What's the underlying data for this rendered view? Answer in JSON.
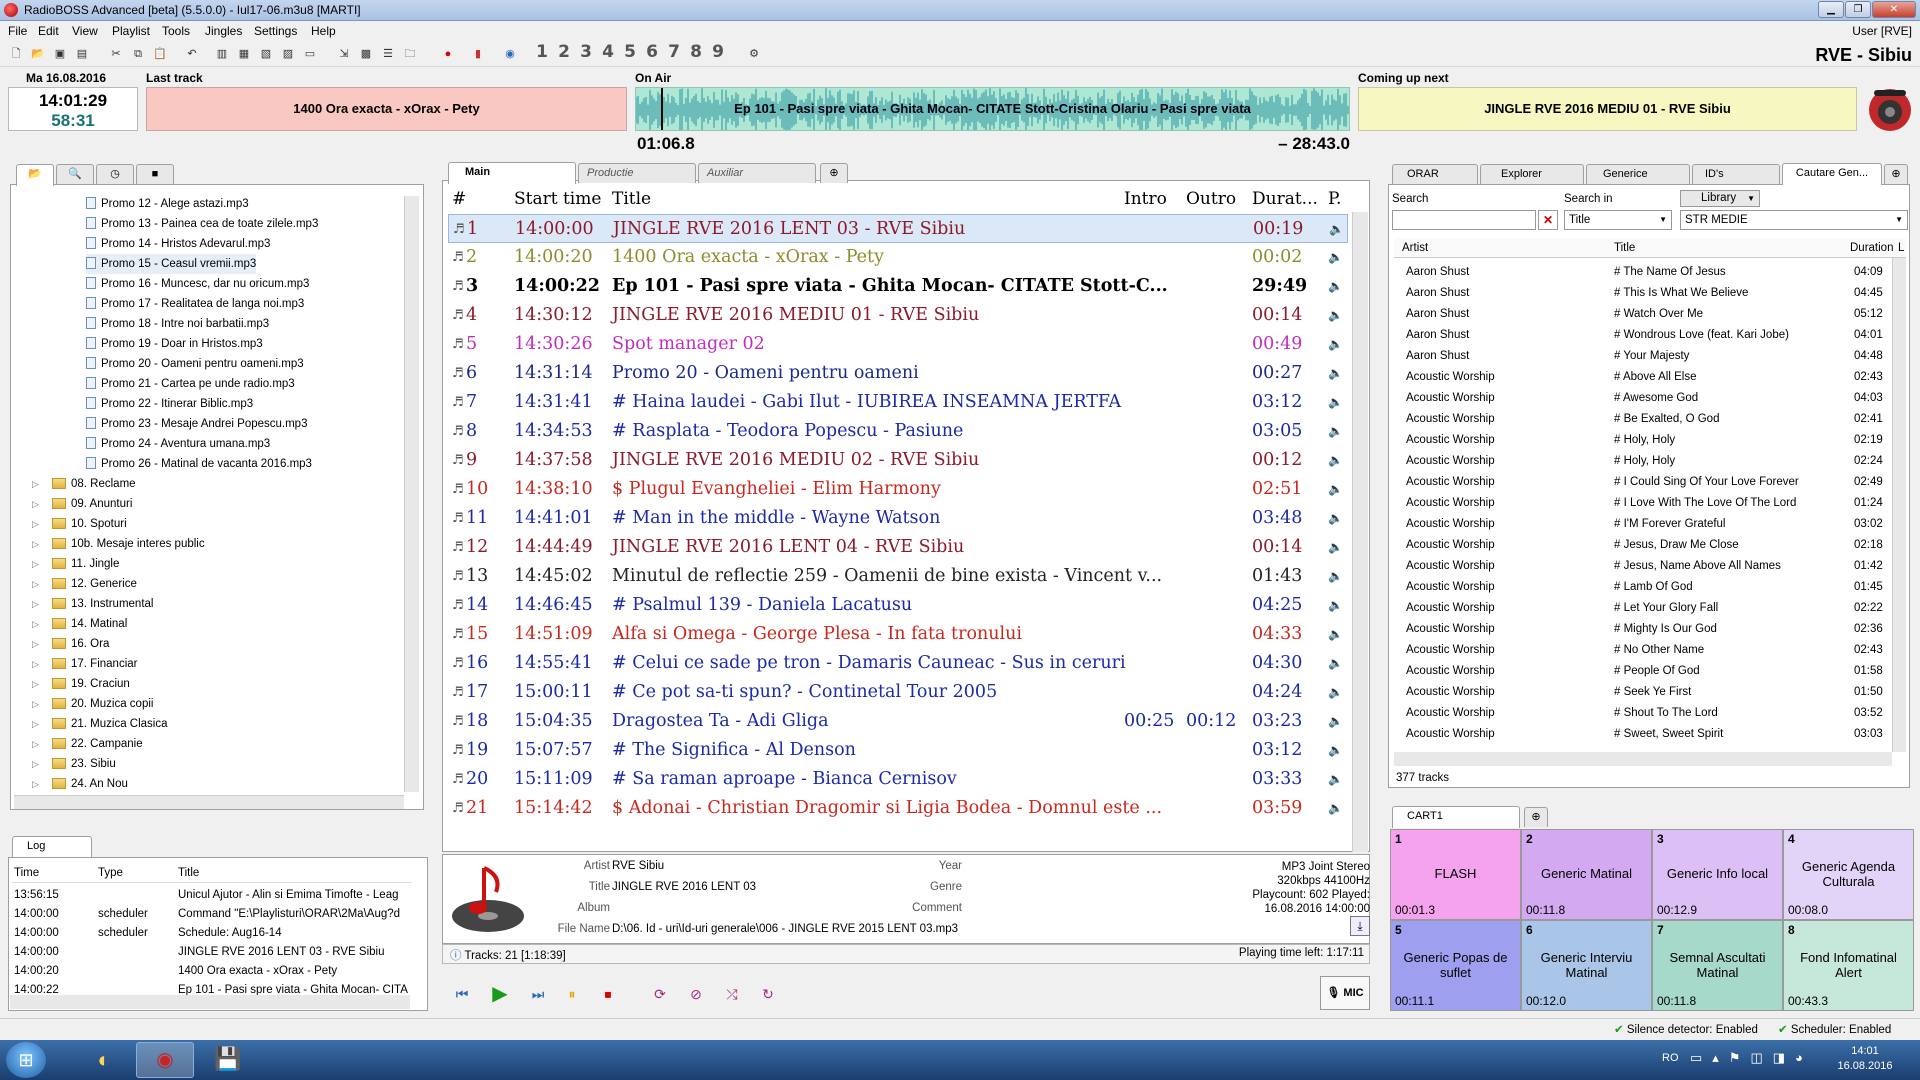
{
  "window": {
    "title": "RadioBOSS Advanced [beta] (5.5.0.0) - Iul17-06.m3u8 [MARTI]"
  },
  "menu": [
    "File",
    "Edit",
    "View",
    "Playlist",
    "Tools",
    "Jingles",
    "Settings",
    "Help"
  ],
  "user": "User [RVE]",
  "station": "RVE - Sibiu",
  "toolbar_numbers": [
    "1",
    "2",
    "3",
    "4",
    "5",
    "6",
    "7",
    "8",
    "9"
  ],
  "clock": {
    "date": "Ma 16.08.2016",
    "time": "14:01:29",
    "countdown": "58:31"
  },
  "last_track": {
    "label": "Last track",
    "title": "1400 Ora exacta - xOrax - Pety"
  },
  "on_air": {
    "label": "On Air",
    "title": "Ep 101 - Pasi spre viata - Ghita Mocan- CITATE Stott-Cristina Olariu - Pasi spre viata",
    "elapsed": "01:06.8",
    "remaining": "– 28:43.0",
    "progress": 0.037
  },
  "coming_up": {
    "label": "Coming up next",
    "title": "JINGLE RVE 2016 MEDIU 01 - RVE Sibiu"
  },
  "left_tree": {
    "files": [
      "Promo 12 - Alege astazi.mp3",
      "Promo 13 - Painea cea de toate zilele.mp3",
      "Promo 14 - Hristos Adevarul.mp3",
      "Promo 15 - Ceasul vremii.mp3",
      "Promo 16 - Muncesc, dar nu oricum.mp3",
      "Promo 17 - Realitatea de langa noi.mp3",
      "Promo 18 - Intre noi barbatii.mp3",
      "Promo 19 - Doar in Hristos.mp3",
      "Promo 20 - Oameni pentru oameni.mp3",
      "Promo 21 - Cartea pe unde radio.mp3",
      "Promo 22 - Itinerar Biblic.mp3",
      "Promo 23 - Mesaje Andrei Popescu.mp3",
      "Promo 24 - Aventura umana.mp3",
      "Promo 26 - Matinal de vacanta 2016.mp3"
    ],
    "folders": [
      "08. Reclame",
      "09. Anunturi",
      "10. Spoturi",
      "10b. Mesaje interes public",
      "11. Jingle",
      "12. Generice",
      "13. Instrumental",
      "14. Matinal",
      "16. Ora",
      "17. Financiar",
      "19. Craciun",
      "20. Muzica copii",
      "21. Muzica Clasica",
      "22. Campanie",
      "23. Sibiu",
      "24. An Nou"
    ]
  },
  "log": {
    "tab": "Log",
    "headers": [
      "Time",
      "Type",
      "Title"
    ],
    "rows": [
      [
        "13:56:15",
        "",
        "Unicul Ajutor - Alin si Emima Timofte - Leag"
      ],
      [
        "14:00:00",
        "scheduler",
        "Command \"E:\\Playlisturi\\ORAR\\2Ma\\Aug?d"
      ],
      [
        "14:00:00",
        "scheduler",
        "Schedule: Aug16-14"
      ],
      [
        "14:00:00",
        "",
        "JINGLE RVE 2016 LENT 03 - RVE Sibiu"
      ],
      [
        "14:00:20",
        "",
        "1400 Ora exacta - xOrax - Pety"
      ],
      [
        "14:00:22",
        "",
        "Ep 101 - Pasi spre viata - Ghita Mocan- CITA"
      ]
    ]
  },
  "playlist": {
    "tabs": [
      "Main",
      "Productie",
      "Auxiliar"
    ],
    "headers": [
      "#",
      "Start time",
      "Title",
      "Intro",
      "Outro",
      "Durat...",
      "P."
    ],
    "rows": [
      {
        "n": "1",
        "start": "14:00:00",
        "title": "JINGLE RVE 2016 LENT 03 - RVE Sibiu",
        "intro": "",
        "outro": "",
        "dur": "00:19",
        "color": "#8b1a2a"
      },
      {
        "n": "2",
        "start": "14:00:20",
        "title": "1400 Ora exacta - xOrax - Pety",
        "intro": "",
        "outro": "",
        "dur": "00:02",
        "color": "#8c8c2a"
      },
      {
        "n": "3",
        "start": "14:00:22",
        "title": "Ep 101 - Pasi spre viata - Ghita Mocan- CITATE Stott-C...",
        "intro": "",
        "outro": "",
        "dur": "29:49",
        "color": "#000000"
      },
      {
        "n": "4",
        "start": "14:30:12",
        "title": "JINGLE RVE 2016 MEDIU 01 - RVE Sibiu",
        "intro": "",
        "outro": "",
        "dur": "00:14",
        "color": "#8b1a2a"
      },
      {
        "n": "5",
        "start": "14:30:26",
        "title": "Spot manager 02",
        "intro": "",
        "outro": "",
        "dur": "00:49",
        "color": "#c02cc0"
      },
      {
        "n": "6",
        "start": "14:31:14",
        "title": "Promo 20 - Oameni pentru oameni",
        "intro": "",
        "outro": "",
        "dur": "00:27",
        "color": "#1a2a8b"
      },
      {
        "n": "7",
        "start": "14:31:41",
        "title": "# Haina laudei - Gabi Ilut - IUBIREA INSEAMNA JERTFA",
        "intro": "",
        "outro": "",
        "dur": "03:12",
        "color": "#1a2aa8"
      },
      {
        "n": "8",
        "start": "14:34:53",
        "title": "# Rasplata - Teodora Popescu - Pasiune",
        "intro": "",
        "outro": "",
        "dur": "03:05",
        "color": "#1a2aa8"
      },
      {
        "n": "9",
        "start": "14:37:58",
        "title": "JINGLE RVE 2016 MEDIU 02 - RVE Sibiu",
        "intro": "",
        "outro": "",
        "dur": "00:12",
        "color": "#8b1a2a"
      },
      {
        "n": "10",
        "start": "14:38:10",
        "title": "$ Plugul Evangheliei - Elim Harmony",
        "intro": "",
        "outro": "",
        "dur": "02:51",
        "color": "#c8281e"
      },
      {
        "n": "11",
        "start": "14:41:01",
        "title": "# Man in the middle - Wayne Watson",
        "intro": "",
        "outro": "",
        "dur": "03:48",
        "color": "#1a2aa8"
      },
      {
        "n": "12",
        "start": "14:44:49",
        "title": "JINGLE RVE 2016 LENT 04 - RVE Sibiu",
        "intro": "",
        "outro": "",
        "dur": "00:14",
        "color": "#8b1a2a"
      },
      {
        "n": "13",
        "start": "14:45:02",
        "title": "Minutul de reflectie 259 - Oamenii de bine exista - Vincent v...",
        "intro": "",
        "outro": "",
        "dur": "01:43",
        "color": "#222222"
      },
      {
        "n": "14",
        "start": "14:46:45",
        "title": "# Psalmul 139 - Daniela Lacatusu",
        "intro": "",
        "outro": "",
        "dur": "04:25",
        "color": "#1a2aa8"
      },
      {
        "n": "15",
        "start": "14:51:09",
        "title": "Alfa si Omega - George Plesa - In fata tronului",
        "intro": "",
        "outro": "",
        "dur": "04:33",
        "color": "#c8281e"
      },
      {
        "n": "16",
        "start": "14:55:41",
        "title": "# Celui ce sade pe tron - Damaris Cauneac - Sus in ceruri",
        "intro": "",
        "outro": "",
        "dur": "04:30",
        "color": "#1a2aa8"
      },
      {
        "n": "17",
        "start": "15:00:11",
        "title": "# Ce pot sa-ti spun? - Continetal Tour 2005",
        "intro": "",
        "outro": "",
        "dur": "04:24",
        "color": "#1a2aa8"
      },
      {
        "n": "18",
        "start": "15:04:35",
        "title": "Dragostea Ta - Adi Gliga",
        "intro": "00:25",
        "outro": "00:12",
        "dur": "03:23",
        "color": "#1a2aa8"
      },
      {
        "n": "19",
        "start": "15:07:57",
        "title": "# The Significa - Al Denson",
        "intro": "",
        "outro": "",
        "dur": "03:12",
        "color": "#1a2aa8"
      },
      {
        "n": "20",
        "start": "15:11:09",
        "title": "# Sa raman aproape - Bianca Cernisov",
        "intro": "",
        "outro": "",
        "dur": "03:33",
        "color": "#1a2aa8"
      },
      {
        "n": "21",
        "start": "15:14:42",
        "title": "$ Adonai - Christian Dragomir si Ligia Bodea - Domnul este ...",
        "intro": "",
        "outro": "",
        "dur": "03:59",
        "color": "#c8281e"
      }
    ]
  },
  "track_info": {
    "labels": {
      "artist": "Artist",
      "title": "Title",
      "album": "Album",
      "filename": "File Name",
      "year": "Year",
      "genre": "Genre",
      "comment": "Comment"
    },
    "artist": "RVE Sibiu",
    "title": "JINGLE RVE 2016 LENT 03",
    "filename": "D:\\06. Id - uri\\Id-uri generale\\006 - JINGLE RVE 2015 LENT 03.mp3",
    "format": "MP3 Joint Stereo",
    "bitrate": "320kbps 44100Hz",
    "playcount": "Playcount: 602  Played:",
    "played": "16.08.2016 14:00:00"
  },
  "status": {
    "tracks": "Tracks: 21 [1:18:39]",
    "playing_left": "Playing time left: 1:17:11",
    "mic": "MIC"
  },
  "library": {
    "tabs": [
      "ORAR",
      "Explorer",
      "Generice",
      "ID's",
      "Cautare Gen..."
    ],
    "search_label": "Search",
    "search_in_label": "Search in",
    "search_value": "",
    "search_in": "Title",
    "library_btn": "Library",
    "library_sel": "STR MEDIE",
    "headers": [
      "Artist",
      "Title",
      "Duration",
      "L"
    ],
    "rows": [
      [
        "Aaron Shust",
        "# The Name Of Jesus",
        "04:09"
      ],
      [
        "Aaron Shust",
        "# This Is What We Believe",
        "04:45"
      ],
      [
        "Aaron Shust",
        "# Watch Over Me",
        "05:12"
      ],
      [
        "Aaron Shust",
        "# Wondrous Love (feat. Kari Jobe)",
        "04:01"
      ],
      [
        "Aaron Shust",
        "# Your Majesty",
        "04:48"
      ],
      [
        "Acoustic Worship",
        "# Above All Else",
        "02:43"
      ],
      [
        "Acoustic Worship",
        "# Awesome God",
        "04:03"
      ],
      [
        "Acoustic Worship",
        "# Be Exalted, O God",
        "02:41"
      ],
      [
        "Acoustic Worship",
        "# Holy, Holy",
        "02:19"
      ],
      [
        "Acoustic Worship",
        "# Holy, Holy",
        "02:24"
      ],
      [
        "Acoustic Worship",
        "# I Could Sing Of Your Love Forever",
        "02:49"
      ],
      [
        "Acoustic Worship",
        "# I Love With The Love Of The Lord",
        "01:24"
      ],
      [
        "Acoustic Worship",
        "# I'M Forever Grateful",
        "03:02"
      ],
      [
        "Acoustic Worship",
        "# Jesus, Draw Me Close",
        "02:18"
      ],
      [
        "Acoustic Worship",
        "# Jesus, Name Above All Names",
        "01:42"
      ],
      [
        "Acoustic Worship",
        "# Lamb Of God",
        "01:45"
      ],
      [
        "Acoustic Worship",
        "# Let Your Glory Fall",
        "02:22"
      ],
      [
        "Acoustic Worship",
        "# Mighty Is Our God",
        "02:36"
      ],
      [
        "Acoustic Worship",
        "# No Other Name",
        "02:43"
      ],
      [
        "Acoustic Worship",
        "# People Of God",
        "01:58"
      ],
      [
        "Acoustic Worship",
        "# Seek Ye First",
        "01:50"
      ],
      [
        "Acoustic Worship",
        "# Shout To The Lord",
        "03:52"
      ],
      [
        "Acoustic Worship",
        "# Sweet, Sweet Spirit",
        "03:03"
      ]
    ],
    "count": "377 tracks"
  },
  "cart": {
    "tab": "CART1",
    "items": [
      {
        "n": "1",
        "name": "FLASH",
        "dur": "00:01.3",
        "color": "#f5a3ef"
      },
      {
        "n": "2",
        "name": "Generic Matinal",
        "dur": "00:11.8",
        "color": "#d3a9f2"
      },
      {
        "n": "3",
        "name": "Generic Info local",
        "dur": "00:12.9",
        "color": "#dcc0f5"
      },
      {
        "n": "4",
        "name": "Generic Agenda Culturala",
        "dur": "00:08.0",
        "color": "#e2d4f8"
      },
      {
        "n": "5",
        "name": "Generic Popas de suflet",
        "dur": "00:11.1",
        "color": "#9f9ff0"
      },
      {
        "n": "6",
        "name": "Generic Interviu Matinal",
        "dur": "00:12.0",
        "color": "#a9c6e8"
      },
      {
        "n": "7",
        "name": "Semnal Ascultati Matinal",
        "dur": "00:11.8",
        "color": "#a6d9c9"
      },
      {
        "n": "8",
        "name": "Fond Infomatinal Alert",
        "dur": "00:43.3",
        "color": "#c6e8da"
      }
    ]
  },
  "statusbar": {
    "silence": "Silence detector: Enabled",
    "scheduler": "Scheduler: Enabled"
  },
  "taskbar": {
    "lang": "RO",
    "time": "14:01",
    "date": "16.08.2016"
  }
}
